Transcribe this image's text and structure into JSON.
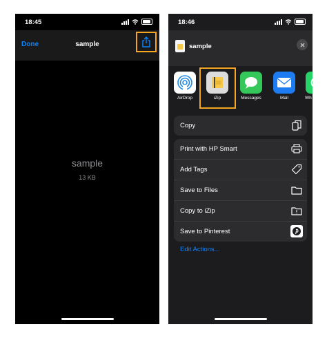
{
  "left": {
    "status": {
      "time": "18:45"
    },
    "nav": {
      "done_label": "Done",
      "title": "sample"
    },
    "file": {
      "name": "sample",
      "size": "13 KB"
    }
  },
  "right": {
    "status": {
      "time": "18:46"
    },
    "sheet": {
      "title": "sample"
    },
    "apps": [
      {
        "label": "AirDrop",
        "icon": "airdrop-icon",
        "color": "#ffffff"
      },
      {
        "label": "iZip",
        "icon": "izip-icon",
        "color": "#dcdcdc"
      },
      {
        "label": "Messages",
        "icon": "messages-icon",
        "color": "#34c759"
      },
      {
        "label": "Mail",
        "icon": "mail-icon",
        "color": "#1e7cf2"
      },
      {
        "label": "Wh",
        "icon": "whatsapp-icon",
        "color": "#25d366"
      }
    ],
    "copy_label": "Copy",
    "actions": [
      {
        "label": "Print with HP Smart",
        "icon": "printer-icon"
      },
      {
        "label": "Add Tags",
        "icon": "tag-icon"
      },
      {
        "label": "Save to Files",
        "icon": "folder-icon"
      },
      {
        "label": "Copy to iZip",
        "icon": "zip-folder-icon"
      },
      {
        "label": "Save to Pinterest",
        "icon": "pinterest-icon"
      }
    ],
    "edit_label": "Edit Actions..."
  },
  "colors": {
    "accent": "#0a84ff",
    "highlight": "#f5a623"
  }
}
